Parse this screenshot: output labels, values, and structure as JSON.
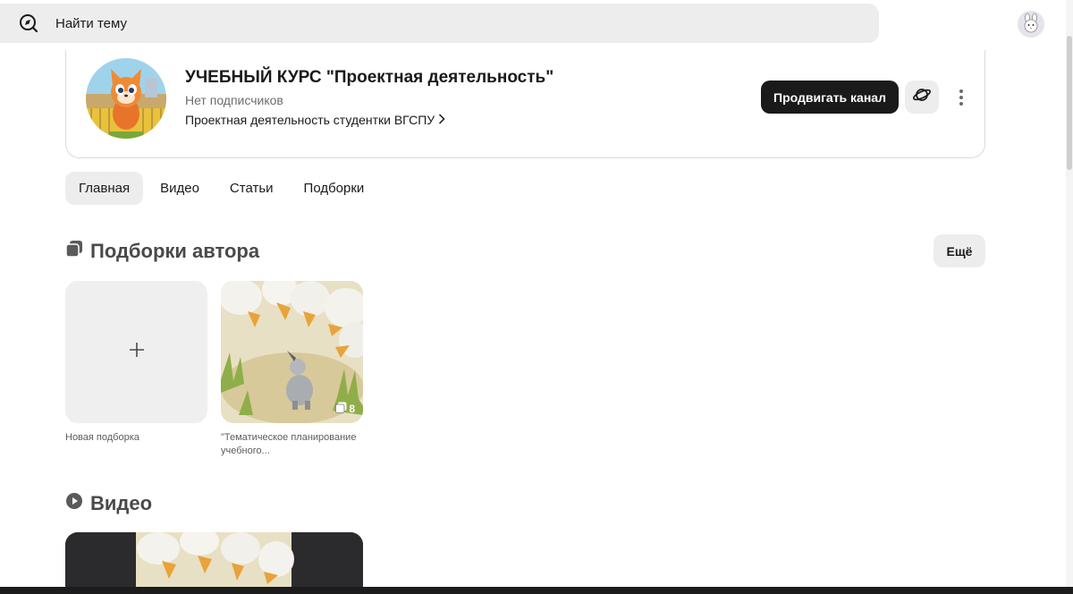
{
  "search": {
    "placeholder": "Найти тему"
  },
  "channel": {
    "title": "УЧЕБНЫЙ КУРС \"Проектная деятельность\"",
    "subscribers": "Нет подписчиков",
    "description": "Проектная деятельность студентки ВГСПУ",
    "promote_label": "Продвигать канал"
  },
  "tabs": [
    {
      "label": "Главная",
      "active": true
    },
    {
      "label": "Видео",
      "active": false
    },
    {
      "label": "Статьи",
      "active": false
    },
    {
      "label": "Подборки",
      "active": false
    }
  ],
  "collections": {
    "title": "Подборки автора",
    "more_label": "Ещё",
    "new_label": "Новая подборка",
    "new_icon": "+",
    "items": [
      {
        "caption": "\"Тематическое планирование учебного...",
        "count": "8"
      }
    ]
  },
  "videos": {
    "title": "Видео"
  },
  "colors": {
    "accent_dark": "#1a1a1a",
    "surface": "#ededee"
  }
}
